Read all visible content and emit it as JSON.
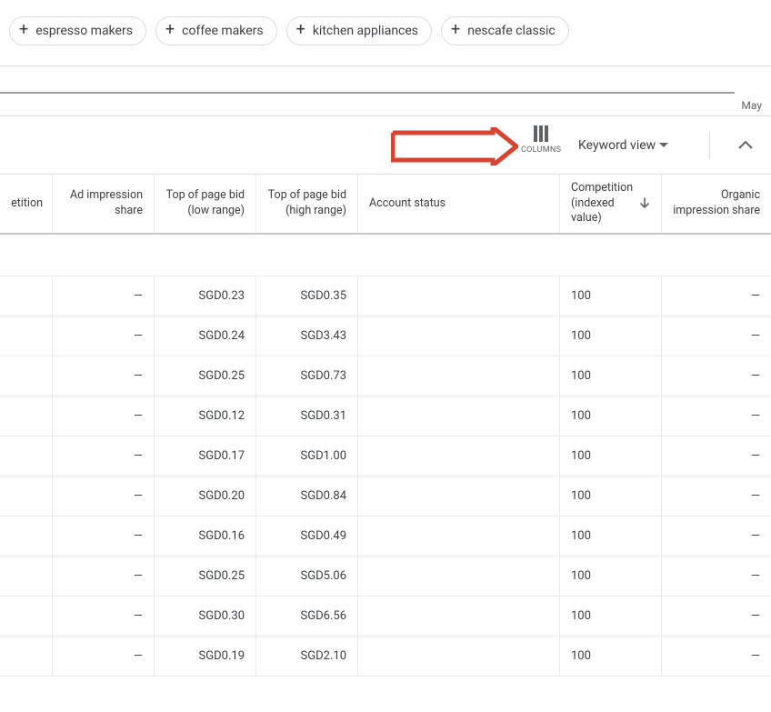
{
  "chips": [
    {
      "label": "espresso makers"
    },
    {
      "label": "coffee makers"
    },
    {
      "label": "kitchen appliances"
    },
    {
      "label": "nescafe classic"
    }
  ],
  "timeline": {
    "end_label": "May"
  },
  "toolbar": {
    "columns_label": "COLUMNS",
    "view_label": "Keyword view"
  },
  "columns": {
    "competition_cut": "etition",
    "ad_impression_share": "Ad impression share",
    "top_bid_low": "Top of page bid (low range)",
    "top_bid_high": "Top of page bid (high range)",
    "account_status": "Account status",
    "competition_indexed": "Competition (indexed value)",
    "organic_impression_share": "Organic impression share"
  },
  "dash": "—",
  "rows": [
    {
      "low": "SGD0.23",
      "high": "SGD0.35",
      "comp": "100"
    },
    {
      "low": "SGD0.24",
      "high": "SGD3.43",
      "comp": "100"
    },
    {
      "low": "SGD0.25",
      "high": "SGD0.73",
      "comp": "100"
    },
    {
      "low": "SGD0.12",
      "high": "SGD0.31",
      "comp": "100"
    },
    {
      "low": "SGD0.17",
      "high": "SGD1.00",
      "comp": "100"
    },
    {
      "low": "SGD0.20",
      "high": "SGD0.84",
      "comp": "100"
    },
    {
      "low": "SGD0.16",
      "high": "SGD0.49",
      "comp": "100"
    },
    {
      "low": "SGD0.25",
      "high": "SGD5.06",
      "comp": "100"
    },
    {
      "low": "SGD0.30",
      "high": "SGD6.56",
      "comp": "100"
    },
    {
      "low": "SGD0.19",
      "high": "SGD2.10",
      "comp": "100"
    }
  ]
}
